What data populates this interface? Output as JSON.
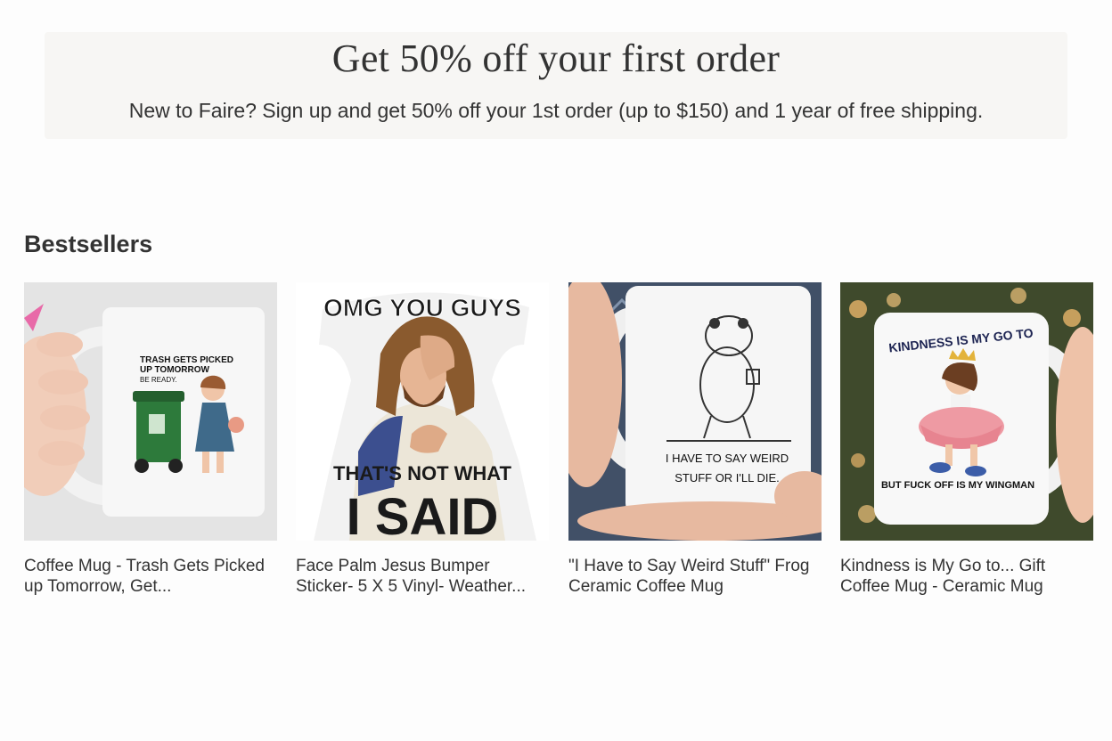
{
  "promo": {
    "title": "Get 50% off your first order",
    "subtitle": "New to Faire? Sign up and get 50% off your 1st order (up to $150) and 1 year of free shipping."
  },
  "bestsellers": {
    "heading": "Bestsellers",
    "products": [
      {
        "name": "Coffee Mug - Trash Gets Picked up Tomorrow, Get...",
        "image_text": [
          "TRASH GETS PICKED",
          "UP TOMORROW",
          "BE READY."
        ]
      },
      {
        "name": "Face Palm Jesus Bumper Sticker- 5 X 5 Vinyl- Weather...",
        "image_text": [
          "OMG YOU GUYS",
          "THAT'S NOT WHAT",
          "I SAID"
        ]
      },
      {
        "name": "\"I Have to Say Weird Stuff\" Frog Ceramic Coffee Mug",
        "image_text": [
          "I HAVE TO SAY WEIRD",
          "STUFF OR I'LL DIE."
        ]
      },
      {
        "name": "Kindness is My Go to... Gift Coffee Mug - Ceramic Mug",
        "image_text": [
          "KINDNESS IS MY GO TO",
          "BUT FUCK OFF IS MY WINGMAN"
        ]
      }
    ]
  }
}
